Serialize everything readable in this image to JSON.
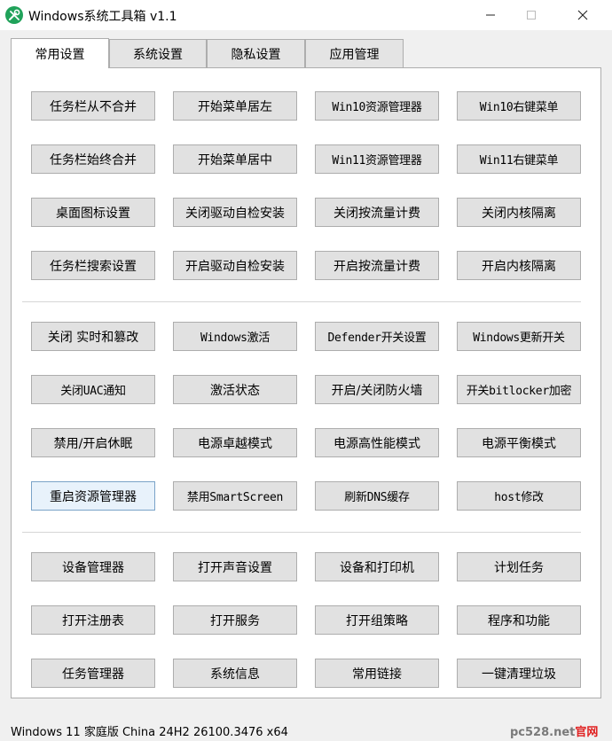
{
  "window": {
    "title": "Windows系统工具箱 v1.1"
  },
  "tabs": [
    {
      "label": "常用设置",
      "active": true
    },
    {
      "label": "系统设置",
      "active": false
    },
    {
      "label": "隐私设置",
      "active": false
    },
    {
      "label": "应用管理",
      "active": false
    }
  ],
  "groups": [
    {
      "rows": [
        [
          "任务栏从不合并",
          "开始菜单居左",
          "Win10资源管理器",
          "Win10右键菜单"
        ],
        [
          "任务栏始终合并",
          "开始菜单居中",
          "Win11资源管理器",
          "Win11右键菜单"
        ],
        [
          "桌面图标设置",
          "关闭驱动自检安装",
          "关闭按流量计费",
          "关闭内核隔离"
        ],
        [
          "任务栏搜索设置",
          "开启驱动自检安装",
          "开启按流量计费",
          "开启内核隔离"
        ]
      ]
    },
    {
      "rows": [
        [
          "关闭 实时和篡改",
          "Windows激活",
          "Defender开关设置",
          "Windows更新开关"
        ],
        [
          "关闭UAC通知",
          "激活状态",
          "开启/关闭防火墙",
          "开关bitlocker加密"
        ],
        [
          "禁用/开启休眠",
          "电源卓越模式",
          "电源高性能模式",
          "电源平衡模式"
        ],
        [
          "重启资源管理器",
          "禁用SmartScreen",
          "刷新DNS缓存",
          "host修改"
        ]
      ]
    },
    {
      "rows": [
        [
          "设备管理器",
          "打开声音设置",
          "设备和打印机",
          "计划任务"
        ],
        [
          "打开注册表",
          "打开服务",
          "打开组策略",
          "程序和功能"
        ],
        [
          "任务管理器",
          "系统信息",
          "常用链接",
          "一键清理垃圾"
        ]
      ]
    }
  ],
  "statusbar": {
    "text": "Windows 11 家庭版 China 24H2 26100.3476 x64"
  },
  "watermark": {
    "site": "pc528.net",
    "tag": "官网"
  },
  "icons": {
    "app": "wrench-screwdriver-icon",
    "minimize": "minimize-icon",
    "maximize": "maximize-icon",
    "close": "close-icon"
  },
  "colors": {
    "app_icon": "#20a25a",
    "watermark_tag": "#e02020",
    "button_face": "#e1e1e1"
  }
}
